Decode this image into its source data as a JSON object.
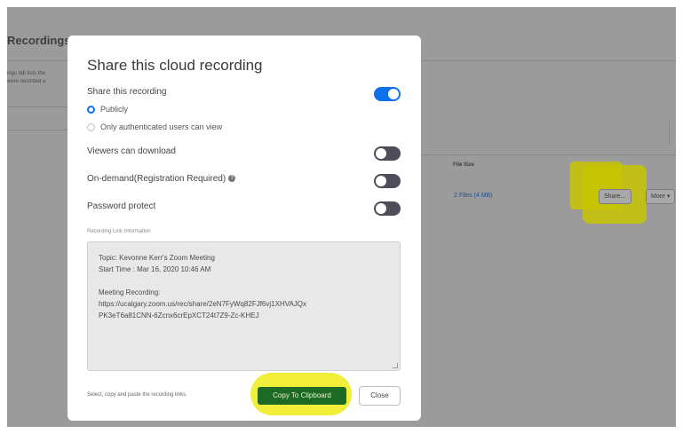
{
  "background": {
    "title": "Recordings",
    "hint_line1": "ings tab lists the",
    "hint_line2": "were recorded a",
    "file_size_header": "File Size",
    "files_link": "2 Files (4 MB)",
    "share_button": "Share...",
    "more_button": "More ▾"
  },
  "modal": {
    "title": "Share this cloud recording",
    "share_label": "Share this recording",
    "share_enabled": true,
    "radio_public": "Publicly",
    "radio_auth": "Only authenticated users can view",
    "viewers_download_label": "Viewers can download",
    "viewers_download_enabled": false,
    "on_demand_label": "On-demand(Registration Required)",
    "on_demand_enabled": false,
    "password_label": "Password protect",
    "password_enabled": false,
    "link_info_label": "Recording Link Information",
    "link_lines": [
      "Topic: Kevonne Kerr's Zoom Meeting",
      "Start Time : Mar 16, 2020 10:46 AM",
      "",
      "Meeting Recording:",
      "https://ucalgary.zoom.us/rec/share/2eN7FyWq82FJf6vj1XHVAJQx",
      "PK3eT6a81CNN-6Zcnx6crEpXCT24t7Z9-Zc-KHEJ"
    ],
    "footer_hint": "Select, copy and paste the recording links.",
    "copy_button": "Copy To Clipboard",
    "close_button": "Close"
  },
  "colors": {
    "accent": "#0e71eb",
    "copy_button": "#1c6a24",
    "highlight": "#f1ee3a"
  }
}
